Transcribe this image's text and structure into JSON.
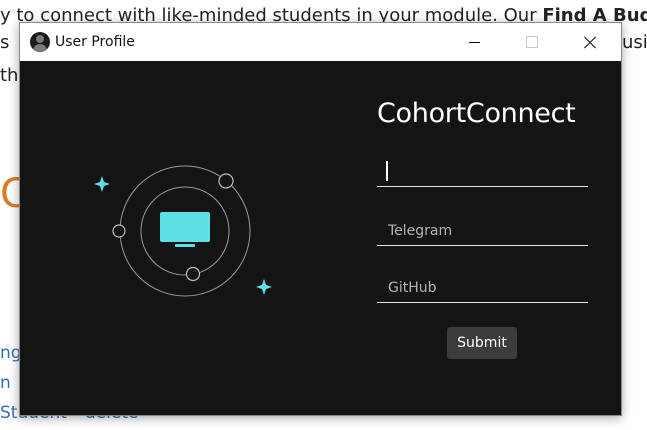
{
  "background": {
    "line1_text": "y to connect with like-minded students in your module. Our ",
    "line1_bold": "Find A Buddy",
    "line2_left": "s",
    "line2_right": "usin",
    "line3_left": "th",
    "big_letter": "C",
    "link1": "ng",
    "link2": "n",
    "link3_student": "Student",
    "link3_delete": "delete"
  },
  "window": {
    "title": "User Profile",
    "controls": {
      "minimize": "minimize-icon",
      "maximize": "maximize-icon",
      "close": "close-icon"
    }
  },
  "form": {
    "brand": "CohortConnect",
    "fields": [
      {
        "placeholder": "",
        "value": ""
      },
      {
        "placeholder": "Telegram",
        "value": ""
      },
      {
        "placeholder": "GitHub",
        "value": ""
      }
    ],
    "submit_label": "Submit"
  },
  "colors": {
    "window_bg": "#141414",
    "accent_cyan": "#5ee0e6",
    "button_bg": "#3c3c3c",
    "bg_heading_orange": "#e07a1f",
    "bg_link_blue": "#2f6fb7"
  }
}
